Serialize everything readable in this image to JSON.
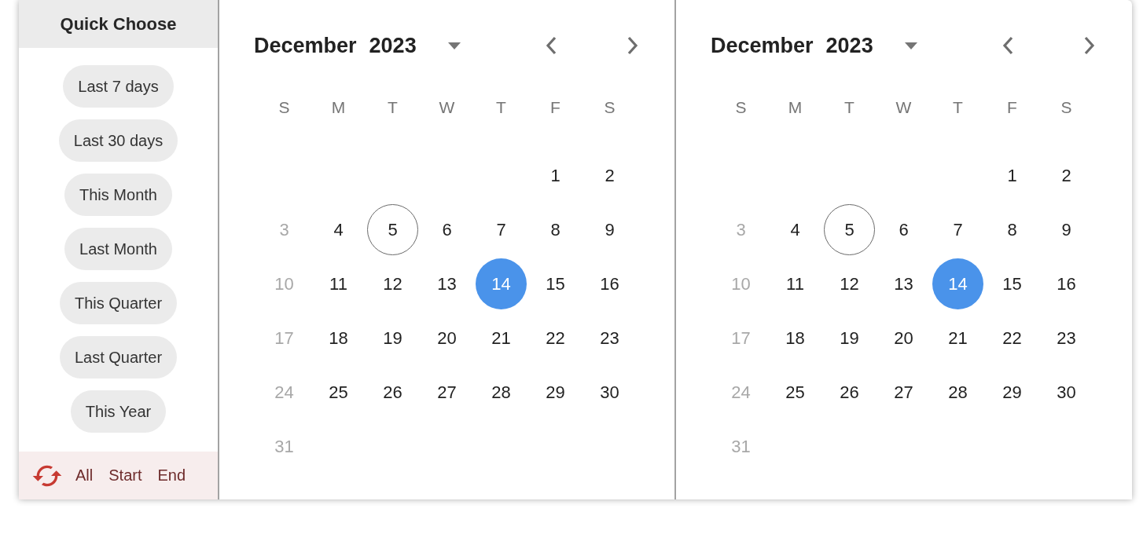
{
  "quick_choose": {
    "title": "Quick Choose",
    "options": [
      "Last 7 days",
      "Last 30 days",
      "This Month",
      "Last Month",
      "This Quarter",
      "Last Quarter",
      "This Year"
    ],
    "footer": {
      "actions": [
        "All",
        "Start",
        "End"
      ]
    }
  },
  "calendars": [
    {
      "month": "December",
      "year": "2023",
      "weekdays": [
        "S",
        "M",
        "T",
        "W",
        "T",
        "F",
        "S"
      ],
      "days": [
        {
          "kind": "empty"
        },
        {
          "kind": "empty"
        },
        {
          "kind": "empty"
        },
        {
          "kind": "empty"
        },
        {
          "kind": "empty"
        },
        {
          "kind": "day",
          "label": "1",
          "disabled": false,
          "today": false,
          "selected": false
        },
        {
          "kind": "day",
          "label": "2",
          "disabled": false,
          "today": false,
          "selected": false
        },
        {
          "kind": "day",
          "label": "3",
          "disabled": true,
          "today": false,
          "selected": false
        },
        {
          "kind": "day",
          "label": "4",
          "disabled": false,
          "today": false,
          "selected": false
        },
        {
          "kind": "day",
          "label": "5",
          "disabled": false,
          "today": true,
          "selected": false
        },
        {
          "kind": "day",
          "label": "6",
          "disabled": false,
          "today": false,
          "selected": false
        },
        {
          "kind": "day",
          "label": "7",
          "disabled": false,
          "today": false,
          "selected": false
        },
        {
          "kind": "day",
          "label": "8",
          "disabled": false,
          "today": false,
          "selected": false
        },
        {
          "kind": "day",
          "label": "9",
          "disabled": false,
          "today": false,
          "selected": false
        },
        {
          "kind": "day",
          "label": "10",
          "disabled": true,
          "today": false,
          "selected": false
        },
        {
          "kind": "day",
          "label": "11",
          "disabled": false,
          "today": false,
          "selected": false
        },
        {
          "kind": "day",
          "label": "12",
          "disabled": false,
          "today": false,
          "selected": false
        },
        {
          "kind": "day",
          "label": "13",
          "disabled": false,
          "today": false,
          "selected": false
        },
        {
          "kind": "day",
          "label": "14",
          "disabled": false,
          "today": false,
          "selected": true
        },
        {
          "kind": "day",
          "label": "15",
          "disabled": false,
          "today": false,
          "selected": false
        },
        {
          "kind": "day",
          "label": "16",
          "disabled": false,
          "today": false,
          "selected": false
        },
        {
          "kind": "day",
          "label": "17",
          "disabled": true,
          "today": false,
          "selected": false
        },
        {
          "kind": "day",
          "label": "18",
          "disabled": false,
          "today": false,
          "selected": false
        },
        {
          "kind": "day",
          "label": "19",
          "disabled": false,
          "today": false,
          "selected": false
        },
        {
          "kind": "day",
          "label": "20",
          "disabled": false,
          "today": false,
          "selected": false
        },
        {
          "kind": "day",
          "label": "21",
          "disabled": false,
          "today": false,
          "selected": false
        },
        {
          "kind": "day",
          "label": "22",
          "disabled": false,
          "today": false,
          "selected": false
        },
        {
          "kind": "day",
          "label": "23",
          "disabled": false,
          "today": false,
          "selected": false
        },
        {
          "kind": "day",
          "label": "24",
          "disabled": true,
          "today": false,
          "selected": false
        },
        {
          "kind": "day",
          "label": "25",
          "disabled": false,
          "today": false,
          "selected": false
        },
        {
          "kind": "day",
          "label": "26",
          "disabled": false,
          "today": false,
          "selected": false
        },
        {
          "kind": "day",
          "label": "27",
          "disabled": false,
          "today": false,
          "selected": false
        },
        {
          "kind": "day",
          "label": "28",
          "disabled": false,
          "today": false,
          "selected": false
        },
        {
          "kind": "day",
          "label": "29",
          "disabled": false,
          "today": false,
          "selected": false
        },
        {
          "kind": "day",
          "label": "30",
          "disabled": false,
          "today": false,
          "selected": false
        },
        {
          "kind": "day",
          "label": "31",
          "disabled": true,
          "today": false,
          "selected": false
        }
      ]
    },
    {
      "month": "December",
      "year": "2023",
      "weekdays": [
        "S",
        "M",
        "T",
        "W",
        "T",
        "F",
        "S"
      ],
      "days": [
        {
          "kind": "empty"
        },
        {
          "kind": "empty"
        },
        {
          "kind": "empty"
        },
        {
          "kind": "empty"
        },
        {
          "kind": "empty"
        },
        {
          "kind": "day",
          "label": "1",
          "disabled": false,
          "today": false,
          "selected": false
        },
        {
          "kind": "day",
          "label": "2",
          "disabled": false,
          "today": false,
          "selected": false
        },
        {
          "kind": "day",
          "label": "3",
          "disabled": true,
          "today": false,
          "selected": false
        },
        {
          "kind": "day",
          "label": "4",
          "disabled": false,
          "today": false,
          "selected": false
        },
        {
          "kind": "day",
          "label": "5",
          "disabled": false,
          "today": true,
          "selected": false
        },
        {
          "kind": "day",
          "label": "6",
          "disabled": false,
          "today": false,
          "selected": false
        },
        {
          "kind": "day",
          "label": "7",
          "disabled": false,
          "today": false,
          "selected": false
        },
        {
          "kind": "day",
          "label": "8",
          "disabled": false,
          "today": false,
          "selected": false
        },
        {
          "kind": "day",
          "label": "9",
          "disabled": false,
          "today": false,
          "selected": false
        },
        {
          "kind": "day",
          "label": "10",
          "disabled": true,
          "today": false,
          "selected": false
        },
        {
          "kind": "day",
          "label": "11",
          "disabled": false,
          "today": false,
          "selected": false
        },
        {
          "kind": "day",
          "label": "12",
          "disabled": false,
          "today": false,
          "selected": false
        },
        {
          "kind": "day",
          "label": "13",
          "disabled": false,
          "today": false,
          "selected": false
        },
        {
          "kind": "day",
          "label": "14",
          "disabled": false,
          "today": false,
          "selected": true
        },
        {
          "kind": "day",
          "label": "15",
          "disabled": false,
          "today": false,
          "selected": false
        },
        {
          "kind": "day",
          "label": "16",
          "disabled": false,
          "today": false,
          "selected": false
        },
        {
          "kind": "day",
          "label": "17",
          "disabled": true,
          "today": false,
          "selected": false
        },
        {
          "kind": "day",
          "label": "18",
          "disabled": false,
          "today": false,
          "selected": false
        },
        {
          "kind": "day",
          "label": "19",
          "disabled": false,
          "today": false,
          "selected": false
        },
        {
          "kind": "day",
          "label": "20",
          "disabled": false,
          "today": false,
          "selected": false
        },
        {
          "kind": "day",
          "label": "21",
          "disabled": false,
          "today": false,
          "selected": false
        },
        {
          "kind": "day",
          "label": "22",
          "disabled": false,
          "today": false,
          "selected": false
        },
        {
          "kind": "day",
          "label": "23",
          "disabled": false,
          "today": false,
          "selected": false
        },
        {
          "kind": "day",
          "label": "24",
          "disabled": true,
          "today": false,
          "selected": false
        },
        {
          "kind": "day",
          "label": "25",
          "disabled": false,
          "today": false,
          "selected": false
        },
        {
          "kind": "day",
          "label": "26",
          "disabled": false,
          "today": false,
          "selected": false
        },
        {
          "kind": "day",
          "label": "27",
          "disabled": false,
          "today": false,
          "selected": false
        },
        {
          "kind": "day",
          "label": "28",
          "disabled": false,
          "today": false,
          "selected": false
        },
        {
          "kind": "day",
          "label": "29",
          "disabled": false,
          "today": false,
          "selected": false
        },
        {
          "kind": "day",
          "label": "30",
          "disabled": false,
          "today": false,
          "selected": false
        },
        {
          "kind": "day",
          "label": "31",
          "disabled": true,
          "today": false,
          "selected": false
        }
      ]
    }
  ]
}
